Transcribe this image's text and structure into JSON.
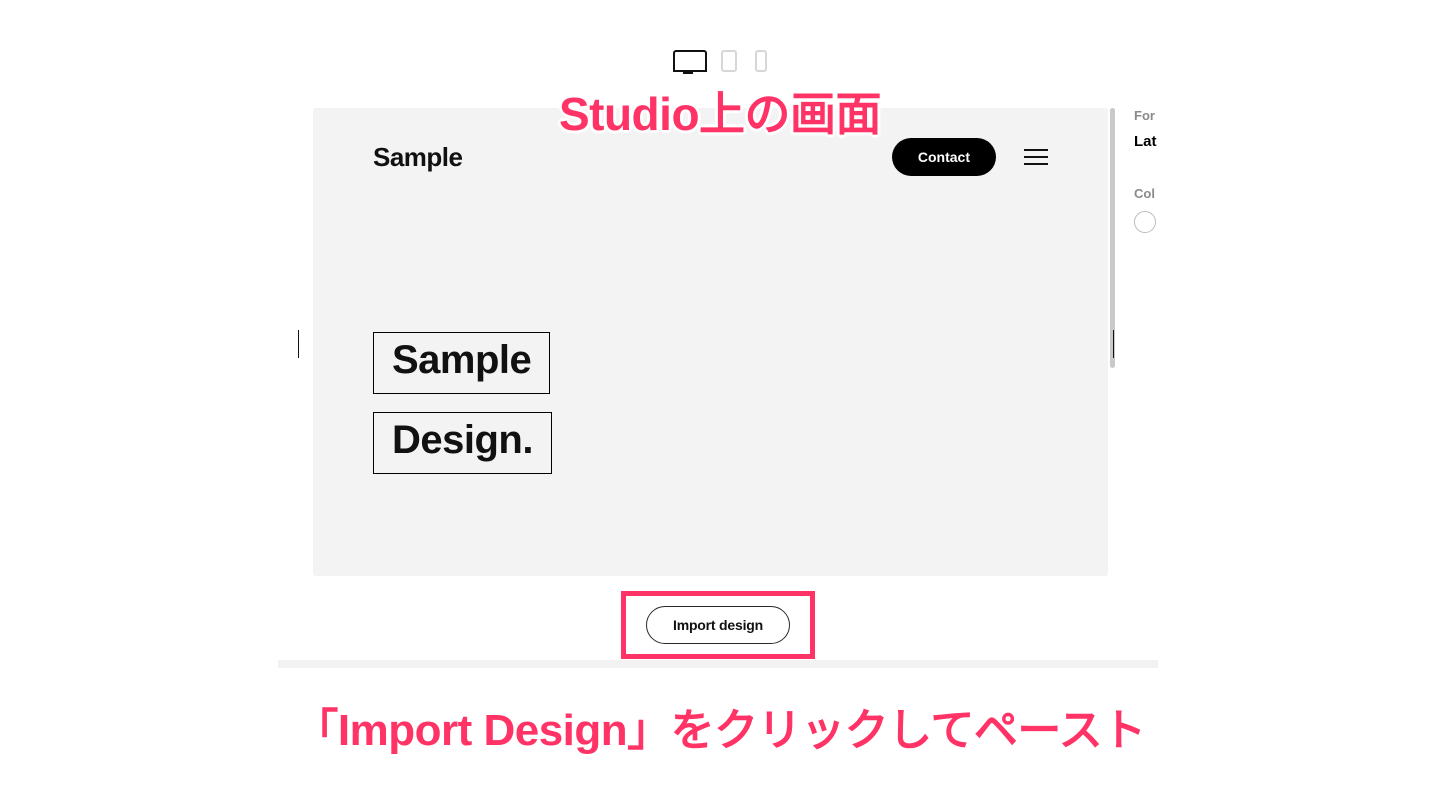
{
  "annotations": {
    "top": "Studio上の画面",
    "bottom": "「Import Design」をクリックしてペースト"
  },
  "device_switcher": {
    "desktop": "desktop",
    "tablet": "tablet",
    "mobile": "mobile",
    "active": "desktop"
  },
  "canvas": {
    "header": {
      "logo": "Sample",
      "contact_label": "Contact"
    },
    "hero": {
      "word1": "Sample",
      "word2": "Design."
    }
  },
  "side_panel": {
    "font_label": "For",
    "font_value": "Lat",
    "color_label": "Col",
    "color_value": "#ffffff"
  },
  "import": {
    "button_label": "Import design"
  },
  "colors": {
    "accent": "#ff3366",
    "ink": "#111111",
    "canvas_bg": "#f3f3f3"
  }
}
